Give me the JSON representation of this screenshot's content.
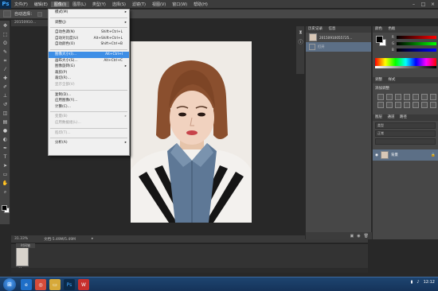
{
  "app": {
    "logo": "Ps"
  },
  "menubar": {
    "items": [
      "文件(F)",
      "编辑(E)",
      "图像(I)",
      "图层(L)",
      "类型(Y)",
      "选择(S)",
      "滤镜(T)",
      "视图(V)",
      "窗口(W)",
      "帮助(H)"
    ],
    "active_index": 2
  },
  "window_controls": [
    "–",
    "□",
    "×"
  ],
  "options_bar": {
    "label": "自动选择："
  },
  "document": {
    "tab_title": "20150910...",
    "zoom": "31.33%",
    "doc_info": "文档:5.49M/5.49M"
  },
  "image_menu": {
    "items": [
      {
        "label": "模式(M)",
        "shortcut": "",
        "submenu": true,
        "disabled": false,
        "highlighted": false
      },
      {
        "separator": true
      },
      {
        "label": "调整(J)",
        "shortcut": "",
        "submenu": true,
        "disabled": false,
        "highlighted": false
      },
      {
        "separator": true
      },
      {
        "label": "自动色调(N)",
        "shortcut": "Shift+Ctrl+L",
        "submenu": false,
        "disabled": false,
        "highlighted": false
      },
      {
        "label": "自动对比度(U)",
        "shortcut": "Alt+Shift+Ctrl+L",
        "submenu": false,
        "disabled": false,
        "highlighted": false
      },
      {
        "label": "自动颜色(O)",
        "shortcut": "Shift+Ctrl+B",
        "submenu": false,
        "disabled": false,
        "highlighted": false
      },
      {
        "separator": true
      },
      {
        "label": "图像大小(I)...",
        "shortcut": "Alt+Ctrl+I",
        "submenu": false,
        "disabled": false,
        "highlighted": true
      },
      {
        "label": "画布大小(S)...",
        "shortcut": "Alt+Ctrl+C",
        "submenu": false,
        "disabled": false,
        "highlighted": false
      },
      {
        "label": "图像旋转(G)",
        "shortcut": "",
        "submenu": true,
        "disabled": false,
        "highlighted": false
      },
      {
        "label": "裁剪(P)",
        "shortcut": "",
        "submenu": false,
        "disabled": false,
        "highlighted": false
      },
      {
        "label": "裁切(R)...",
        "shortcut": "",
        "submenu": false,
        "disabled": false,
        "highlighted": false
      },
      {
        "label": "显示全部(V)",
        "shortcut": "",
        "submenu": false,
        "disabled": true,
        "highlighted": false
      },
      {
        "separator": true
      },
      {
        "label": "复制(D)...",
        "shortcut": "",
        "submenu": false,
        "disabled": false,
        "highlighted": false
      },
      {
        "label": "应用图像(Y)...",
        "shortcut": "",
        "submenu": false,
        "disabled": false,
        "highlighted": false
      },
      {
        "label": "计算(C)...",
        "shortcut": "",
        "submenu": false,
        "disabled": false,
        "highlighted": false
      },
      {
        "separator": true
      },
      {
        "label": "变量(B)",
        "shortcut": "",
        "submenu": true,
        "disabled": true,
        "highlighted": false
      },
      {
        "label": "应用数据组(L)...",
        "shortcut": "",
        "submenu": false,
        "disabled": true,
        "highlighted": false
      },
      {
        "separator": true
      },
      {
        "label": "陷印(T)...",
        "shortcut": "",
        "submenu": false,
        "disabled": true,
        "highlighted": false
      },
      {
        "separator": true
      },
      {
        "label": "分析(A)",
        "shortcut": "",
        "submenu": true,
        "disabled": false,
        "highlighted": false
      }
    ]
  },
  "history_panel": {
    "tabs": [
      "历史记录",
      "信息"
    ],
    "snapshot_label": "20150910055725...",
    "state_label": "打开"
  },
  "color_panel": {
    "tabs": [
      "颜色",
      "色板"
    ],
    "channels": [
      "R",
      "G",
      "B"
    ]
  },
  "adjustments_panel": {
    "tabs": [
      "调整",
      "样式"
    ],
    "title": "添加调整"
  },
  "layers_panel": {
    "tabs": [
      "图层",
      "通道",
      "路径"
    ],
    "kind_label": "类型",
    "blend_mode": "正常",
    "layer_name": "背景"
  },
  "filmstrip": {
    "tab": "时间轴",
    "thumb_label": "01"
  },
  "taskbar": {
    "apps": [
      "ie",
      "chrome",
      "folder",
      "ps",
      "wps"
    ],
    "time": "12:12"
  }
}
